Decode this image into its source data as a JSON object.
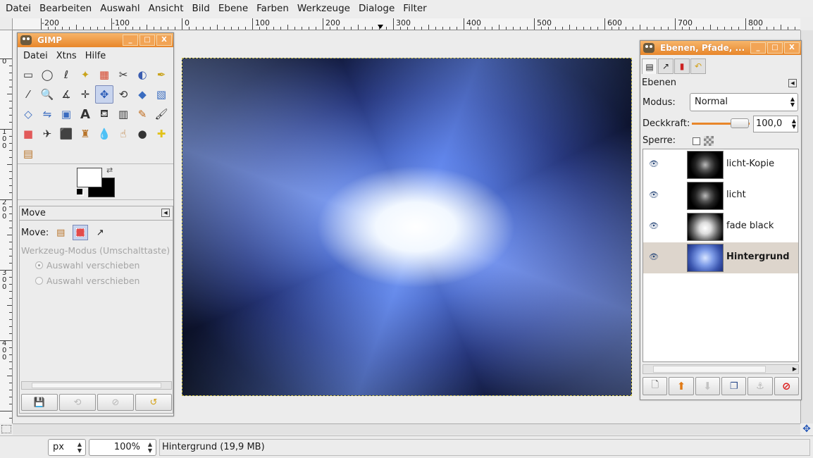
{
  "menubar": {
    "items": [
      "Datei",
      "Bearbeiten",
      "Auswahl",
      "Ansicht",
      "Bild",
      "Ebene",
      "Farben",
      "Werkzeuge",
      "Dialoge",
      "Filter"
    ]
  },
  "ruler": {
    "h_labels": [
      "-200",
      "-100",
      "0",
      "100",
      "200",
      "300",
      "400",
      "500",
      "600",
      "700",
      "800"
    ],
    "v_labels": [
      "0",
      "1 0 0",
      "2 0 0",
      "3 0 0",
      "4 0 0"
    ]
  },
  "toolbox": {
    "title": "GIMP",
    "menu": [
      "Datei",
      "Xtns",
      "Hilfe"
    ],
    "window_buttons": [
      "_",
      "□",
      "X"
    ]
  },
  "tool_options": {
    "title": "Move",
    "move_label": "Move:",
    "mode_label": "Werkzeug-Modus (Umschalttaste)",
    "radio1": "Auswahl verschieben",
    "radio2": "Auswahl verschieben"
  },
  "layers_dock": {
    "title": "Ebenen, Pfade, ...",
    "panel_title": "Ebenen",
    "mode_label": "Modus:",
    "mode_value": "Normal",
    "opacity_label": "Deckkraft:",
    "opacity_value": "100,0",
    "opacity_fraction": 1.0,
    "lock_label": "Sperre:",
    "layers": [
      {
        "name": "licht-Kopie",
        "visible": true,
        "selected": false
      },
      {
        "name": "licht",
        "visible": true,
        "selected": false
      },
      {
        "name": "fade black",
        "visible": true,
        "selected": false
      },
      {
        "name": "Hintergrund",
        "visible": true,
        "selected": true
      }
    ]
  },
  "statusbar": {
    "unit": "px",
    "zoom": "100%",
    "message": "Hintergrund (19,9 MB)"
  },
  "icons": {
    "eye": "eye-icon",
    "nav": "navigate-icon",
    "quickmask": "quickmask-icon"
  },
  "colors": {
    "titlebar": "#e8862a",
    "foreground": "#ffffff",
    "background": "#000000",
    "selection": "#ddd5cc"
  }
}
